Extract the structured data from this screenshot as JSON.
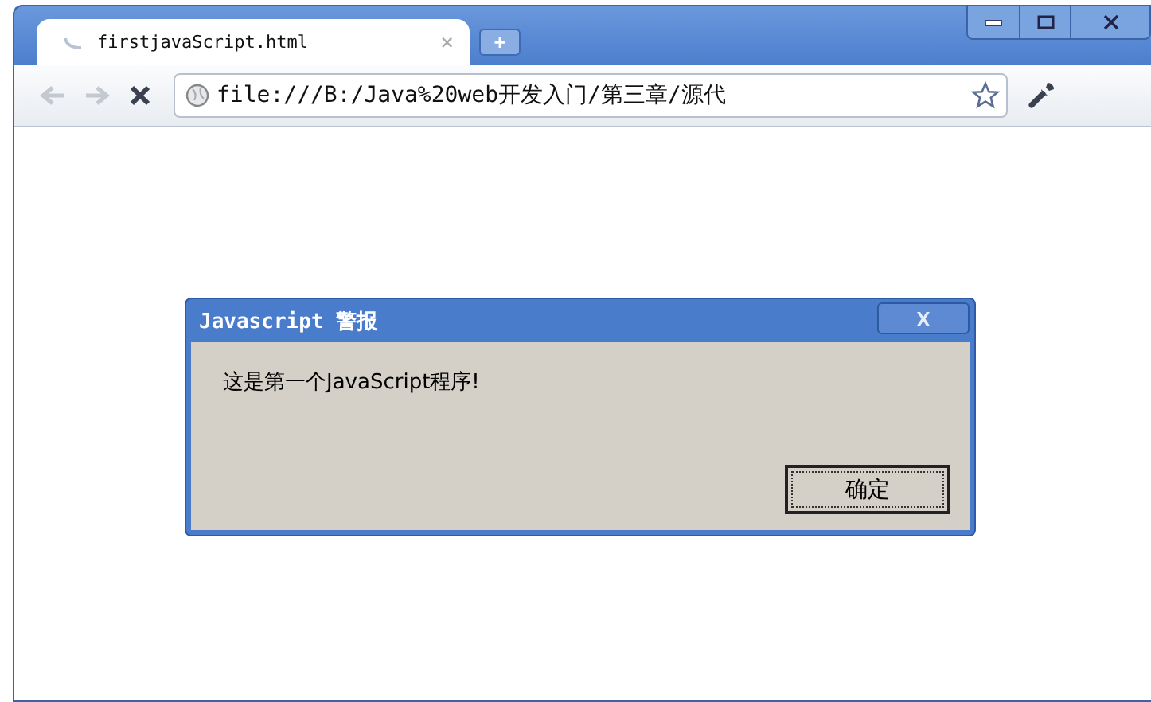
{
  "tabs": [
    {
      "label": "firstjavaScript.html",
      "selected": true,
      "close": "×"
    }
  ],
  "new_tab": "+",
  "nav": [
    {
      "kind": "back",
      "disabled": true
    },
    {
      "kind": "forward",
      "disabled": true
    },
    {
      "kind": "stop",
      "disabled": false
    }
  ],
  "address": {
    "value": "file:///B:/Java%20web开发入门/第三章/源代"
  },
  "dialog": {
    "title": "Javascript 警报",
    "close": "X",
    "message": "这是第一个JavaScript程序!",
    "button": "确定"
  }
}
